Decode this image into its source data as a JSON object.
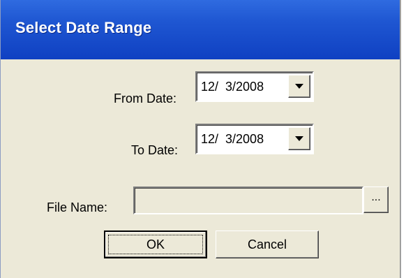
{
  "window": {
    "title": "Select Date Range"
  },
  "form": {
    "from_date": {
      "label": "From Date:",
      "value": "12/  3/2008"
    },
    "to_date": {
      "label": "To Date:",
      "value": "12/  3/2008"
    },
    "file_name": {
      "label": "File Name:",
      "value": "",
      "browse_label": "..."
    }
  },
  "buttons": {
    "ok_label": "OK",
    "cancel_label": "Cancel"
  },
  "icons": {
    "dropdown": "chevron-down-icon"
  },
  "colors": {
    "titlebar": "#0f40c2",
    "dialog_bg": "#ece9d8",
    "title_text": "#ffffff"
  }
}
